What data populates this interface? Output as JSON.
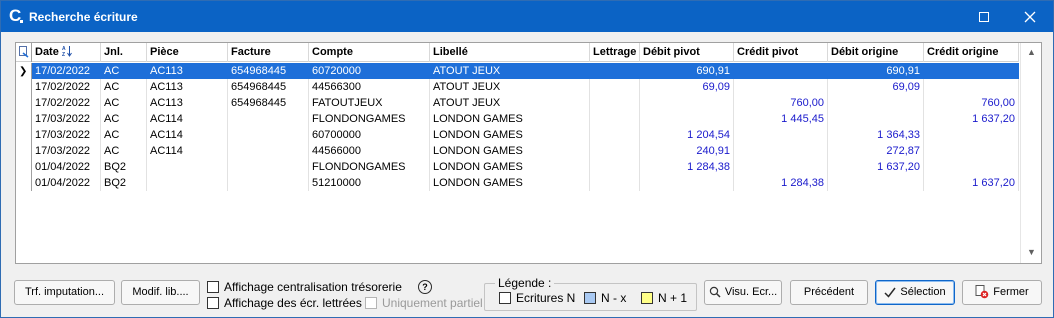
{
  "window": {
    "title": "Recherche écriture"
  },
  "grid": {
    "columns": [
      {
        "key": "date",
        "label": "Date"
      },
      {
        "key": "jnl",
        "label": "Jnl."
      },
      {
        "key": "piece",
        "label": "Pièce"
      },
      {
        "key": "facture",
        "label": "Facture"
      },
      {
        "key": "compte",
        "label": "Compte"
      },
      {
        "key": "libelle",
        "label": "Libellé"
      },
      {
        "key": "lettrage",
        "label": "Lettrage"
      },
      {
        "key": "debit_pivot",
        "label": "Débit pivot"
      },
      {
        "key": "credit_pivot",
        "label": "Crédit pivot"
      },
      {
        "key": "debit_origine",
        "label": "Débit origine"
      },
      {
        "key": "credit_origine",
        "label": "Crédit origine"
      }
    ],
    "rows": [
      {
        "date": "17/02/2022",
        "jnl": "AC",
        "piece": "AC113",
        "facture": "654968445",
        "compte": "60720000",
        "libelle": "ATOUT JEUX",
        "lettrage": "",
        "debit_pivot": "690,91",
        "credit_pivot": "",
        "debit_origine": "690,91",
        "credit_origine": "",
        "selected": true
      },
      {
        "date": "17/02/2022",
        "jnl": "AC",
        "piece": "AC113",
        "facture": "654968445",
        "compte": "44566300",
        "libelle": "ATOUT JEUX",
        "lettrage": "",
        "debit_pivot": "69,09",
        "credit_pivot": "",
        "debit_origine": "69,09",
        "credit_origine": ""
      },
      {
        "date": "17/02/2022",
        "jnl": "AC",
        "piece": "AC113",
        "facture": "654968445",
        "compte": "FATOUTJEUX",
        "libelle": "ATOUT JEUX",
        "lettrage": "",
        "debit_pivot": "",
        "credit_pivot": "760,00",
        "debit_origine": "",
        "credit_origine": "760,00"
      },
      {
        "date": "17/03/2022",
        "jnl": "AC",
        "piece": "AC114",
        "facture": "",
        "compte": "FLONDONGAMES",
        "libelle": "LONDON GAMES",
        "lettrage": "",
        "debit_pivot": "",
        "credit_pivot": "1 445,45",
        "debit_origine": "",
        "credit_origine": "1 637,20"
      },
      {
        "date": "17/03/2022",
        "jnl": "AC",
        "piece": "AC114",
        "facture": "",
        "compte": "60700000",
        "libelle": "LONDON GAMES",
        "lettrage": "",
        "debit_pivot": "1 204,54",
        "credit_pivot": "",
        "debit_origine": "1 364,33",
        "credit_origine": ""
      },
      {
        "date": "17/03/2022",
        "jnl": "AC",
        "piece": "AC114",
        "facture": "",
        "compte": "44566000",
        "libelle": "LONDON GAMES",
        "lettrage": "",
        "debit_pivot": "240,91",
        "credit_pivot": "",
        "debit_origine": "272,87",
        "credit_origine": ""
      },
      {
        "date": "01/04/2022",
        "jnl": "BQ2",
        "piece": "",
        "facture": "",
        "compte": "FLONDONGAMES",
        "libelle": "LONDON GAMES",
        "lettrage": "",
        "debit_pivot": "1 284,38",
        "credit_pivot": "",
        "debit_origine": "1 637,20",
        "credit_origine": ""
      },
      {
        "date": "01/04/2022",
        "jnl": "BQ2",
        "piece": "",
        "facture": "",
        "compte": "51210000",
        "libelle": "LONDON GAMES",
        "lettrage": "",
        "debit_pivot": "",
        "credit_pivot": "1 284,38",
        "debit_origine": "",
        "credit_origine": "1 637,20"
      }
    ]
  },
  "buttons": {
    "trf_imputation": "Trf. imputation...",
    "modif_lib": "Modif. lib....",
    "visu_ecr": "Visu. Ecr...",
    "precedent": "Précédent",
    "selection": "Sélection",
    "fermer": "Fermer"
  },
  "options": {
    "affichage_centralisation": "Affichage centralisation trésorerie",
    "affichage_lettrees": "Affichage des écr. lettrées",
    "uniquement_partiel": "Uniquement partiel",
    "help": "?"
  },
  "legend": {
    "title": "Légende :",
    "items": [
      {
        "label": "Ecritures N",
        "color": "#ffffff"
      },
      {
        "label": "N - x",
        "color": "#a9c9f2"
      },
      {
        "label": "N + 1",
        "color": "#ffff88"
      }
    ]
  },
  "colors": {
    "accent": "#0b63c5",
    "selected_row": "#1e6fd9",
    "amount_text": "#1a1acc"
  }
}
